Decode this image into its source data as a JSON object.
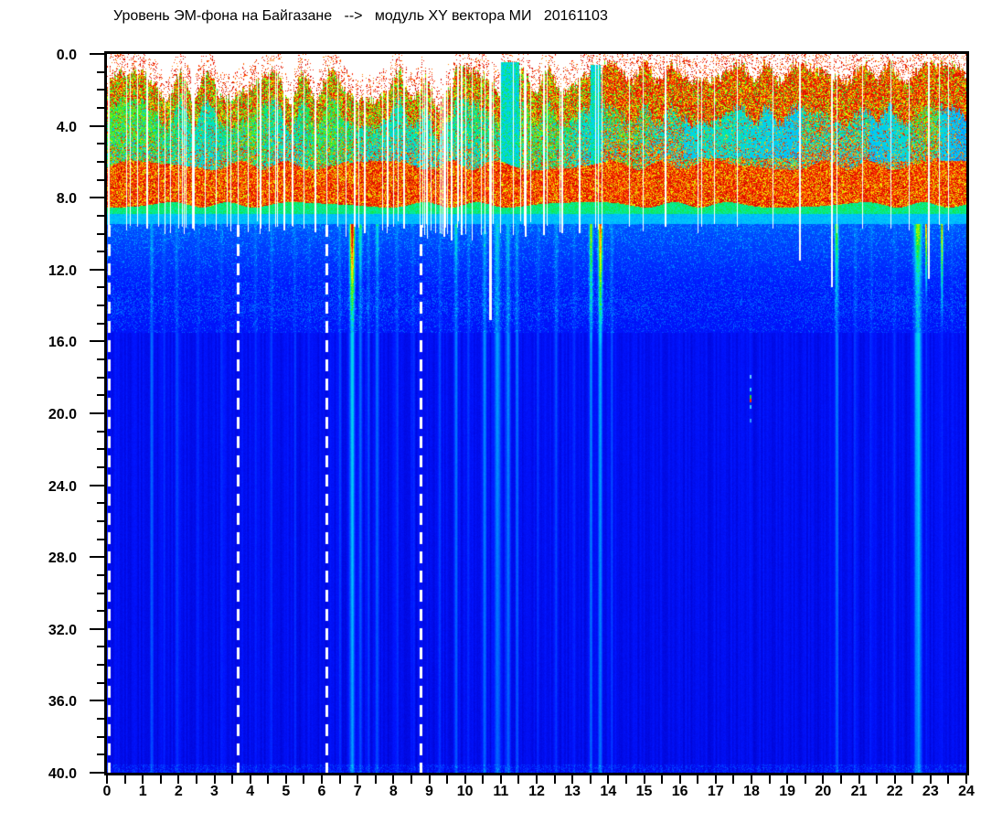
{
  "title": "Уровень ЭМ-фона на Байгазане   -->   модуль XY вектора МИ   20161103",
  "chart_data": {
    "type": "heatmap",
    "title": "Уровень ЭМ-фона на Байгазане   -->   модуль XY вектора МИ   20161103",
    "station": "Байгазан",
    "channel": "модуль XY вектора МИ",
    "date": "20161103",
    "grid": false,
    "legend": false,
    "x_axis": {
      "min": 0,
      "max": 24,
      "major_step": 1,
      "minor_step": 0.5,
      "labels": [
        "0",
        "1",
        "2",
        "3",
        "4",
        "5",
        "6",
        "7",
        "8",
        "9",
        "10",
        "11",
        "12",
        "13",
        "14",
        "15",
        "16",
        "17",
        "18",
        "19",
        "20",
        "21",
        "22",
        "23",
        "24"
      ]
    },
    "y_axis": {
      "min": 0,
      "max": 40,
      "major_step": 4,
      "minor_step": 1,
      "inverted": true,
      "labels": [
        "0.0",
        "4.0",
        "8.0",
        "12.0",
        "16.0",
        "20.0",
        "24.0",
        "28.0",
        "32.0",
        "36.0",
        "40.0"
      ]
    },
    "colormap": [
      {
        "v": 0.0,
        "rgb": [
          0,
          0,
          143
        ]
      },
      {
        "v": 0.08,
        "rgb": [
          0,
          0,
          200
        ]
      },
      {
        "v": 0.16,
        "rgb": [
          0,
          20,
          255
        ]
      },
      {
        "v": 0.28,
        "rgb": [
          0,
          110,
          255
        ]
      },
      {
        "v": 0.38,
        "rgb": [
          0,
          200,
          255
        ]
      },
      {
        "v": 0.46,
        "rgb": [
          0,
          235,
          190
        ]
      },
      {
        "v": 0.54,
        "rgb": [
          20,
          230,
          60
        ]
      },
      {
        "v": 0.62,
        "rgb": [
          150,
          245,
          0
        ]
      },
      {
        "v": 0.7,
        "rgb": [
          250,
          250,
          0
        ]
      },
      {
        "v": 0.8,
        "rgb": [
          255,
          150,
          0
        ]
      },
      {
        "v": 0.9,
        "rgb": [
          255,
          30,
          0
        ]
      },
      {
        "v": 1.0,
        "rgb": [
          190,
          0,
          0
        ]
      }
    ],
    "no_data_color": "#ffffff",
    "model": {
      "note": "procedural description of the spectrogram content",
      "red_band": {
        "top": 6.2,
        "bottom": 8.4
      },
      "green_band_end": 8.9,
      "cyan_band_end": 9.45,
      "speckle_band_center": 13.9,
      "segment_format": [
        "t1",
        "top_min",
        "top_max",
        "red_top",
        "red_depth",
        "speck",
        "gap_prob"
      ],
      "segments": [
        [
          3.66,
          1.0,
          2.5,
          0.45,
          1.6,
          0.17,
          0.09
        ],
        [
          8.7,
          1.0,
          2.6,
          0.45,
          1.6,
          0.19,
          0.11
        ],
        [
          9.7,
          1.3,
          3.0,
          0.5,
          1.8,
          0.2,
          0.46
        ],
        [
          11.0,
          0.8,
          2.4,
          0.5,
          1.8,
          0.22,
          0.26
        ],
        [
          13.9,
          0.7,
          2.2,
          0.5,
          1.9,
          0.24,
          0.13
        ],
        [
          24.01,
          0.55,
          1.5,
          0.62,
          2.4,
          0.42,
          0.03
        ]
      ],
      "streak_format": [
        "t_hours",
        "amplitude",
        "width_hours",
        "hot_amplitude",
        "hot_length_units"
      ],
      "streaks": [
        [
          1.25,
          0.45,
          0.045,
          0,
          0
        ],
        [
          1.6,
          0.18,
          0.04,
          0,
          0
        ],
        [
          1.95,
          0.3,
          0.045,
          0,
          0
        ],
        [
          2.55,
          0.15,
          0.04,
          0,
          0
        ],
        [
          3.2,
          0.18,
          0.04,
          0,
          0
        ],
        [
          4.15,
          0.22,
          0.045,
          0,
          0
        ],
        [
          4.6,
          0.25,
          0.04,
          0,
          0
        ],
        [
          5.25,
          0.2,
          0.04,
          0,
          0
        ],
        [
          5.65,
          0.15,
          0.035,
          0,
          0
        ],
        [
          6.5,
          0.3,
          0.04,
          0,
          0
        ],
        [
          6.85,
          0.95,
          0.065,
          0.55,
          6
        ],
        [
          7.08,
          0.5,
          0.045,
          0.15,
          4
        ],
        [
          7.3,
          0.3,
          0.04,
          0,
          0
        ],
        [
          7.55,
          0.45,
          0.045,
          0.1,
          3
        ],
        [
          8.1,
          0.3,
          0.04,
          0,
          0
        ],
        [
          8.55,
          0.2,
          0.04,
          0,
          0
        ],
        [
          9.3,
          0.25,
          0.04,
          0,
          0
        ],
        [
          9.75,
          0.5,
          0.05,
          0.1,
          3
        ],
        [
          10.1,
          0.3,
          0.04,
          0,
          0
        ],
        [
          10.55,
          0.55,
          0.055,
          0,
          0
        ],
        [
          10.9,
          0.7,
          0.085,
          0,
          0
        ],
        [
          11.2,
          0.6,
          0.06,
          0,
          0
        ],
        [
          11.45,
          0.45,
          0.05,
          0,
          0
        ],
        [
          12.05,
          0.2,
          0.05,
          0,
          0
        ],
        [
          12.55,
          0.35,
          0.05,
          0,
          0
        ],
        [
          13.05,
          0.2,
          0.04,
          0,
          0
        ],
        [
          13.52,
          0.55,
          0.045,
          0.3,
          7
        ],
        [
          13.78,
          0.75,
          0.055,
          0.45,
          7
        ],
        [
          14.1,
          0.3,
          0.045,
          0,
          0
        ],
        [
          17.95,
          0.1,
          0.03,
          0,
          0
        ],
        [
          20.38,
          0.55,
          0.05,
          0.25,
          5
        ],
        [
          20.9,
          0.22,
          0.04,
          0,
          0
        ],
        [
          21.35,
          0.18,
          0.04,
          0,
          0
        ],
        [
          22.0,
          0.14,
          0.05,
          0,
          0
        ],
        [
          22.65,
          0.9,
          0.1,
          0.2,
          4
        ],
        [
          22.88,
          0.25,
          0.025,
          0.6,
          4.5
        ],
        [
          23.32,
          0.22,
          0.03,
          0.5,
          6
        ],
        [
          23.6,
          0.15,
          0.03,
          0,
          0
        ]
      ],
      "gap_format": [
        "t_hours",
        "white_depth_units",
        "width_hours"
      ],
      "gaps": [
        [
          0.06,
          9.5,
          0.05
        ],
        [
          0.55,
          9.8,
          0.035
        ],
        [
          0.85,
          9.6,
          0.03
        ],
        [
          1.12,
          9.7,
          0.035
        ],
        [
          1.45,
          9.6,
          0.03
        ],
        [
          1.78,
          10.0,
          0.035
        ],
        [
          2.1,
          9.6,
          0.03
        ],
        [
          2.4,
          9.7,
          0.035
        ],
        [
          2.75,
          9.6,
          0.03
        ],
        [
          3.05,
          9.8,
          0.035
        ],
        [
          3.35,
          9.6,
          0.03
        ],
        [
          3.66,
          9.7,
          0.04
        ],
        [
          3.95,
          9.9,
          0.035
        ],
        [
          4.3,
          9.7,
          0.03
        ],
        [
          4.72,
          9.6,
          0.03
        ],
        [
          4.95,
          9.8,
          0.035
        ],
        [
          5.2,
          9.6,
          0.03
        ],
        [
          5.5,
          9.7,
          0.03
        ],
        [
          5.82,
          9.9,
          0.035
        ],
        [
          6.14,
          9.7,
          0.04
        ],
        [
          6.45,
          9.6,
          0.03
        ],
        [
          6.68,
          10.2,
          0.035
        ],
        [
          6.92,
          9.6,
          0.03
        ],
        [
          7.2,
          10.0,
          0.035
        ],
        [
          7.7,
          9.8,
          0.035
        ],
        [
          8.0,
          9.6,
          0.03
        ],
        [
          8.3,
          9.7,
          0.035
        ],
        [
          8.75,
          9.7,
          0.04
        ],
        [
          8.95,
          10.3,
          0.04
        ],
        [
          9.18,
          10.0,
          0.04
        ],
        [
          9.42,
          10.2,
          0.04
        ],
        [
          9.62,
          10.4,
          0.045
        ],
        [
          9.9,
          10.1,
          0.04
        ],
        [
          10.2,
          10.4,
          0.045
        ],
        [
          10.45,
          10.1,
          0.04
        ],
        [
          10.72,
          14.8,
          0.08
        ],
        [
          11.7,
          10.2,
          0.04
        ],
        [
          12.2,
          10.1,
          0.04
        ],
        [
          12.72,
          10.0,
          0.04
        ],
        [
          13.2,
          10.0,
          0.04
        ],
        [
          14.6,
          9.6,
          0.03
        ],
        [
          15.6,
          9.6,
          0.03
        ],
        [
          16.6,
          9.6,
          0.03
        ],
        [
          17.6,
          9.6,
          0.03
        ],
        [
          18.6,
          9.7,
          0.03
        ],
        [
          19.35,
          11.5,
          0.045
        ],
        [
          20.25,
          13.0,
          0.055
        ],
        [
          21.1,
          9.7,
          0.03
        ],
        [
          21.9,
          9.7,
          0.03
        ],
        [
          22.4,
          9.8,
          0.03
        ],
        [
          22.95,
          12.5,
          0.065
        ],
        [
          23.5,
          9.8,
          0.03
        ]
      ],
      "dashed_lines_t": [
        0.06,
        3.66,
        6.14,
        8.75
      ],
      "dashed_line_start_u": 9.5,
      "cool_patch_format": [
        "t0",
        "t1",
        "u0",
        "u1",
        "delta"
      ],
      "cool_patches": [
        [
          16.1,
          19.4,
          2.3,
          5.8,
          -0.1
        ],
        [
          21.3,
          22.45,
          1.2,
          6.0,
          -0.08
        ],
        [
          23.25,
          24.0,
          2.0,
          6.2,
          -0.13
        ]
      ],
      "cool_burst_format": [
        "t0",
        "t1",
        "top_u"
      ],
      "cool_bursts": [
        [
          10.98,
          11.52,
          0.45
        ],
        [
          13.5,
          13.78,
          0.6
        ]
      ],
      "anomaly": {
        "t": 17.95,
        "dots": [
          [
            17.85,
            "#66ccff"
          ],
          [
            18.55,
            "#33ccff"
          ],
          [
            19.0,
            "#33cc33"
          ],
          [
            19.2,
            "#ff3300"
          ],
          [
            19.55,
            "#33ccff"
          ],
          [
            20.3,
            "#3399ff"
          ]
        ]
      }
    }
  }
}
